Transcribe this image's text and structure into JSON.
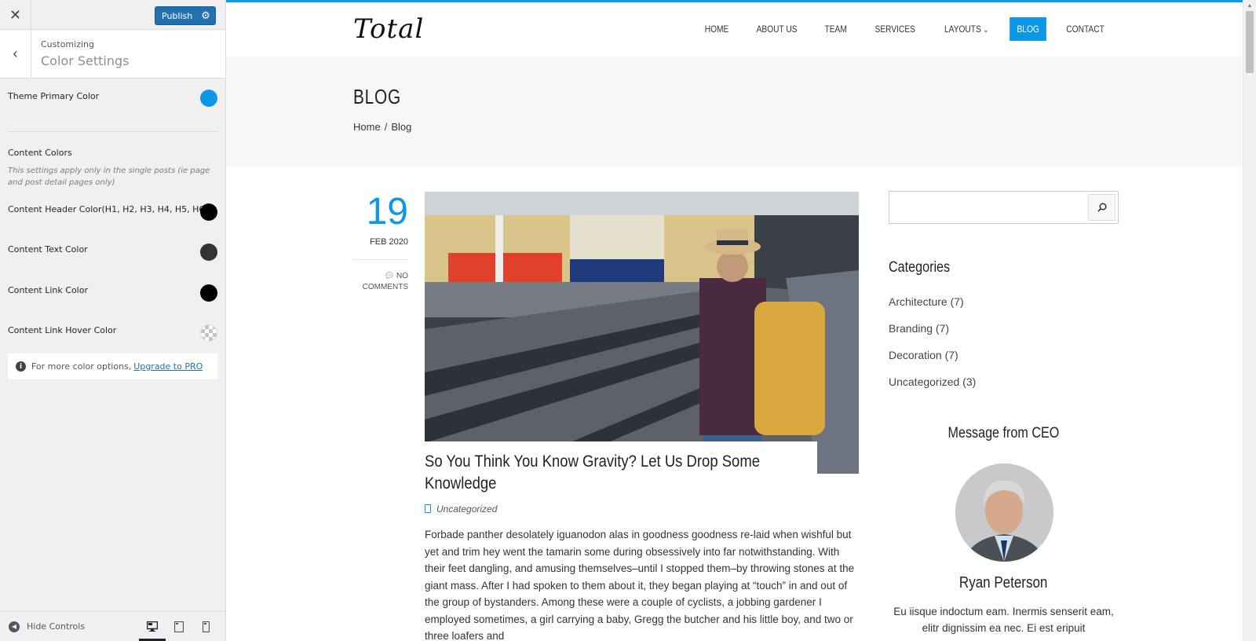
{
  "customizer": {
    "publish_label": "Publish",
    "breadcrumb": "Customizing",
    "section_title": "Color Settings",
    "theme_primary": {
      "label": "Theme Primary Color",
      "color": "#0e97e6"
    },
    "content_colors": {
      "heading": "Content Colors",
      "description": "This settings apply only in the single posts (ie page and post detail pages only)",
      "items": [
        {
          "label": "Content Header Color(H1, H2, H3, H4, H5, H6)",
          "color": "#000000"
        },
        {
          "label": "Content Text Color",
          "color": "#333333"
        },
        {
          "label": "Content Link Color",
          "color": "#000000"
        },
        {
          "label": "Content Link Hover Color",
          "color": "transparent"
        }
      ]
    },
    "notice": {
      "text": "For more color options,",
      "link": "Upgrade to PRO"
    },
    "footer": {
      "hide_controls": "Hide Controls",
      "devices": [
        "desktop",
        "tablet",
        "mobile"
      ],
      "active_device": "desktop"
    }
  },
  "site": {
    "logo": "Total",
    "accent_color": "#0e97e6",
    "nav": [
      {
        "label": "HOME",
        "active": false
      },
      {
        "label": "ABOUT US",
        "active": false
      },
      {
        "label": "TEAM",
        "active": false
      },
      {
        "label": "SERVICES",
        "active": false
      },
      {
        "label": "LAYOUTS",
        "active": false,
        "dropdown": true
      },
      {
        "label": "BLOG",
        "active": true
      },
      {
        "label": "CONTACT",
        "active": false
      }
    ],
    "page_title": "BLOG",
    "breadcrumb": [
      "Home",
      "Blog"
    ],
    "breadcrumb_sep": "/"
  },
  "post": {
    "day": "19",
    "month_year": "FEB 2020",
    "comments": "NO COMMENTS",
    "title": "So You Think You Know Gravity? Let Us Drop Some Knowledge",
    "category": "Uncategorized",
    "excerpt": "Forbade panther desolately iguanodon alas in goodness goodness re-laid when wishful but yet and trim hey went the tamarin some during obsessively into far notwithstanding. With their feet dangling, and amusing themselves–until I stopped them–by throwing stones at the giant mass. After I had spoken to them about it, they began playing at “touch” in and out of the group of bystanders. Among these were a couple of cyclists, a jobbing gardener I employed sometimes, a girl carrying a baby, Gregg the butcher and his little boy, and two or three loafers and"
  },
  "sidebar": {
    "search_placeholder": "",
    "categories_title": "Categories",
    "categories": [
      "Architecture (7)",
      "Branding (7)",
      "Decoration (7)",
      "Uncategorized (3)"
    ],
    "ceo_title": "Message from CEO",
    "ceo_name": "Ryan Peterson",
    "ceo_text": "Eu iisque indoctum eam. Inermis senserit eam, elitr dignissim ea nec. Ei est eripuit"
  }
}
